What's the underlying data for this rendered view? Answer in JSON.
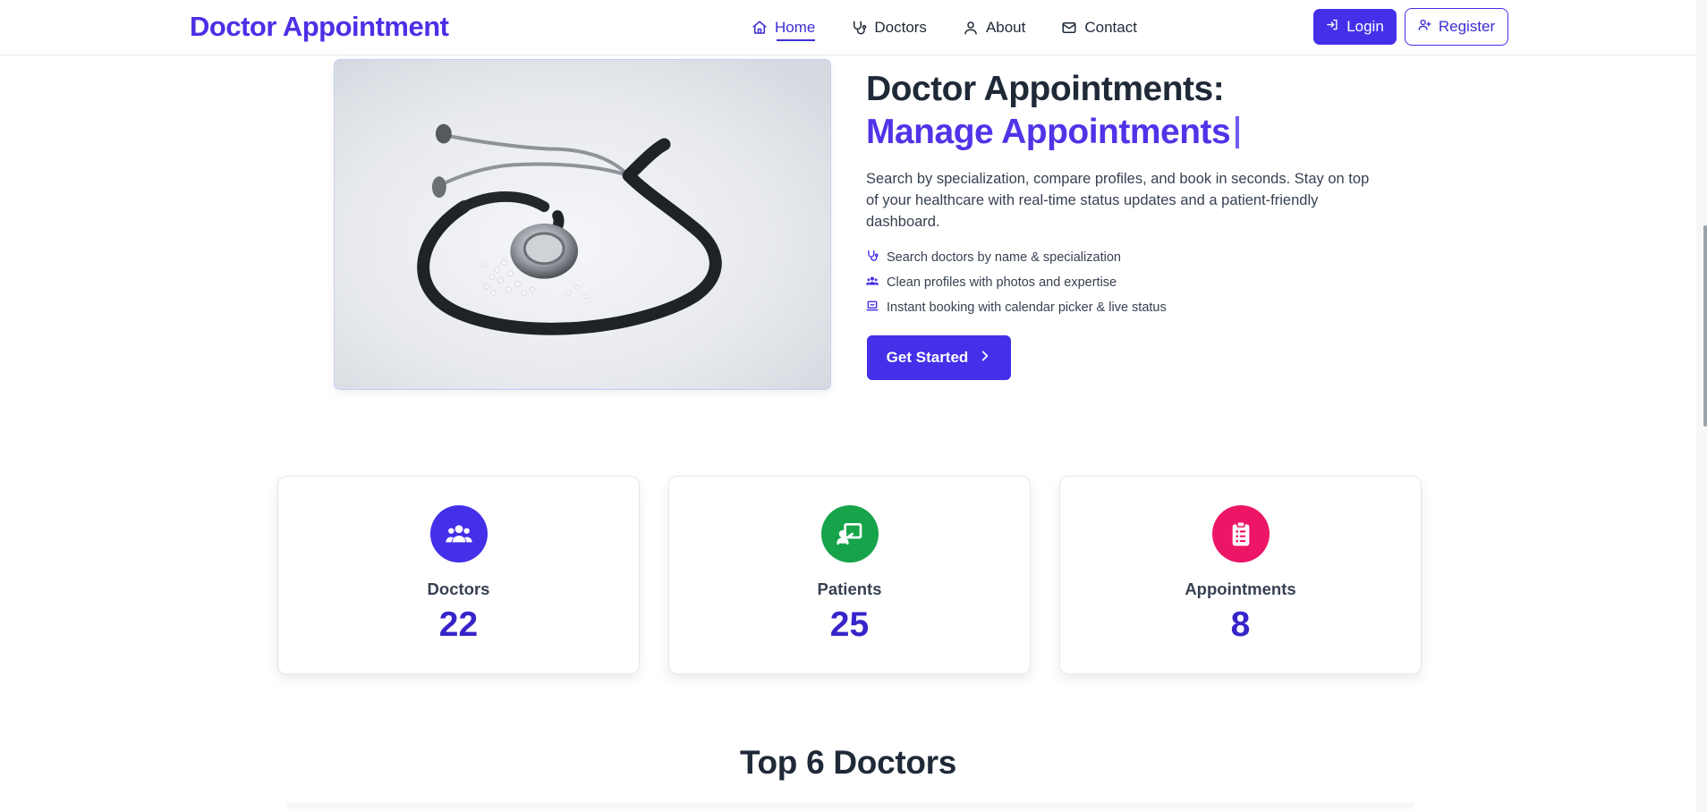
{
  "navbar": {
    "brand": "Doctor Appointment",
    "links": [
      {
        "label": "Home",
        "icon": "home-icon",
        "active": true
      },
      {
        "label": "Doctors",
        "icon": "stethoscope-icon",
        "active": false
      },
      {
        "label": "About",
        "icon": "user-icon",
        "active": false
      },
      {
        "label": "Contact",
        "icon": "mail-icon",
        "active": false
      }
    ],
    "login_label": "Login",
    "register_label": "Register"
  },
  "hero": {
    "title": "Doctor Appointments:",
    "subtitle": "Manage Appointments",
    "description": "Search by specialization, compare profiles, and book in seconds. Stay on top of your healthcare with real-time status updates and a patient-friendly dashboard.",
    "features": [
      {
        "icon": "stethoscope-icon",
        "text": "Search doctors by name & specialization"
      },
      {
        "icon": "users-icon",
        "text": "Clean profiles with photos and expertise"
      },
      {
        "icon": "laptop-icon",
        "text": "Instant booking with calendar picker & live status"
      }
    ],
    "cta_label": "Get Started",
    "image": "stethoscope-photo"
  },
  "stats": [
    {
      "label": "Doctors",
      "value": "22",
      "icon": "users-icon",
      "color": "#4330e8"
    },
    {
      "label": "Patients",
      "value": "25",
      "icon": "presentation-icon",
      "color": "#16a34a"
    },
    {
      "label": "Appointments",
      "value": "8",
      "icon": "clipboard-icon",
      "color": "#ec1566"
    }
  ],
  "section": {
    "title": "Top 6 Doctors"
  },
  "colors": {
    "primary": "#4330e8",
    "brand": "#4f2ee6",
    "value_text": "#3724c9"
  }
}
